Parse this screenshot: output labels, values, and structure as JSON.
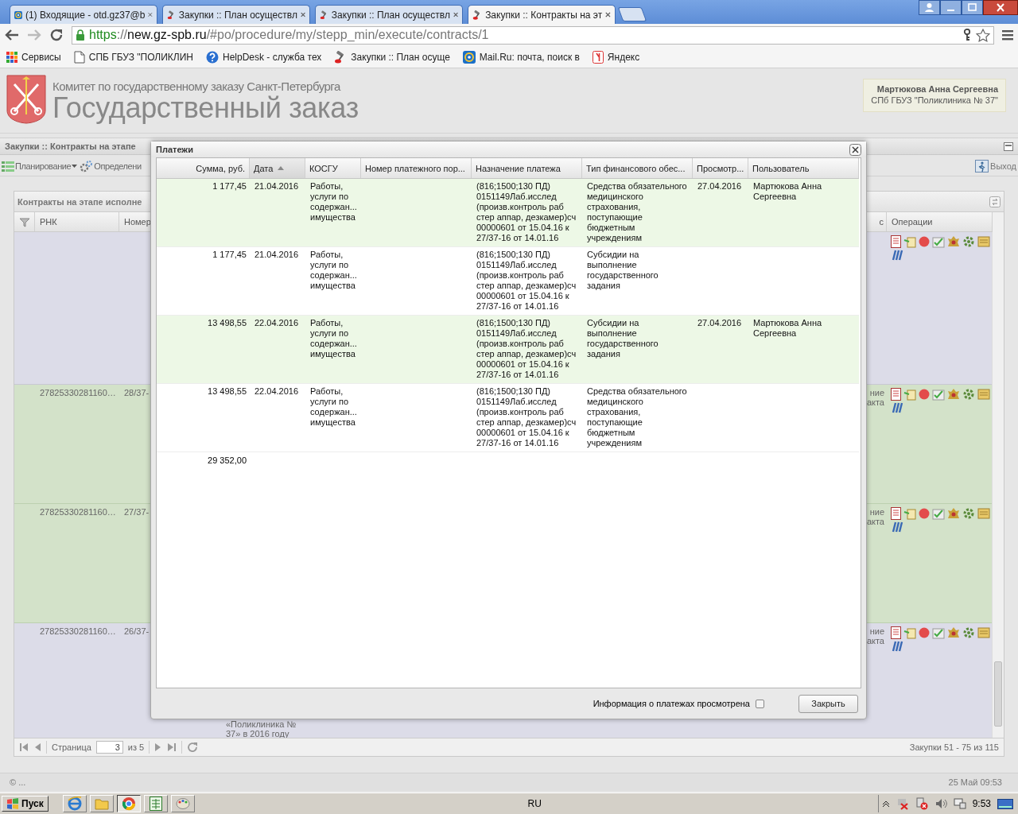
{
  "browser": {
    "tabs": [
      {
        "title": "(1) Входящие - otd.gz37@b",
        "kind": "mail",
        "selected": false
      },
      {
        "title": "Закупки :: План осуществл",
        "kind": "site",
        "selected": false
      },
      {
        "title": "Закупки :: План осуществл",
        "kind": "site",
        "selected": false
      },
      {
        "title": "Закупки :: Контракты на эт",
        "kind": "site",
        "selected": true
      }
    ],
    "address": [
      {
        "text": "https",
        "kind": "scheme"
      },
      {
        "text": "://",
        "kind": "plain"
      },
      {
        "text": "new.gz-spb.ru",
        "kind": "host"
      },
      {
        "text": "/#po/procedure/my/stepp_min/execute/contracts/1",
        "kind": "plain"
      }
    ],
    "bookmarks": [
      {
        "label": "Сервисы",
        "kind": "apps"
      },
      {
        "label": "СПБ ГБУЗ \"ПОЛИКЛИН",
        "kind": "page"
      },
      {
        "label": "HelpDesk - служба тех",
        "kind": "help"
      },
      {
        "label": "Закупки :: План осуще",
        "kind": "site"
      },
      {
        "label": "Mail.Ru: почта, поиск в",
        "kind": "mail"
      },
      {
        "label": "Яндекс",
        "kind": "yandex"
      }
    ]
  },
  "header": {
    "subtitle": "Комитет по государственному заказу Санкт-Петербурга",
    "title": "Государственный заказ",
    "user": {
      "name": "Мартюкова Анна Сергеевна",
      "org": "СПб ГБУЗ \"Поликлиника № 37\""
    }
  },
  "panel": {
    "title": "Закупки :: Контракты на этапе",
    "toolbar": [
      {
        "label": "Планирование",
        "kind": "menu"
      },
      {
        "label": "Определени",
        "kind": "gear"
      }
    ],
    "exit": "Выход",
    "grid": {
      "title": "Контракты на этапе исполне",
      "columns": [
        "РНК",
        "Номер",
        "с",
        "Операции"
      ],
      "rows": [
        {
          "highlighted": false
        },
        {
          "rnk": "27825330281160…",
          "number": "28/37-",
          "status": [
            "ние",
            "акта"
          ],
          "highlighted": true
        },
        {
          "rnk": "27825330281160…",
          "number": "27/37-",
          "status": [
            "ние",
            "акта"
          ],
          "highlighted": true
        },
        {
          "rnk": "27825330281160…",
          "number": "26/37-",
          "status": [
            "ние",
            "акта"
          ],
          "note": "«Поликлиника № 37» в 2016 году",
          "highlighted": false
        }
      ],
      "pager": {
        "page_label": "Страница",
        "page": "3",
        "of": "из 5",
        "summary": "Закупки 51 - 75 из 115"
      }
    }
  },
  "dialog": {
    "title": "Платежи",
    "columns": [
      {
        "label": "Сумма, руб.",
        "sorted": false
      },
      {
        "label": "Дата",
        "sorted": true
      },
      {
        "label": "КОСГУ",
        "sorted": false
      },
      {
        "label": "Номер платежного пор...",
        "sorted": false
      },
      {
        "label": "Назначение платежа",
        "sorted": false
      },
      {
        "label": "Тип финансового обес...",
        "sorted": false
      },
      {
        "label": "Просмотр...",
        "sorted": false
      },
      {
        "label": "Пользователь",
        "sorted": false
      }
    ],
    "rows": [
      {
        "sum": "1 177,45",
        "date": "21.04.2016",
        "kosgu": "Работы, услуги по содержан... имущества",
        "purpose": "(816;1500;130 ПД) 0151149Лаб.исслед (произв.контроль раб стер аппар, дезкамер)сч 00000601 от 15.04.16 к 27/37-16 от 14.01.16",
        "funding": "Средства обязательного медицинского страхования, поступающие бюджетным учреждениям",
        "viewed_on": "27.04.2016",
        "user": "Мартюкова Анна Сергеевна",
        "highlighted": true
      },
      {
        "sum": "1 177,45",
        "date": "21.04.2016",
        "kosgu": "Работы, услуги по содержан... имущества",
        "purpose": "(816;1500;130 ПД) 0151149Лаб.исслед (произв.контроль раб стер аппар, дезкамер)сч 00000601 от 15.04.16 к 27/37-16 от 14.01.16",
        "funding": "Субсидии на выполнение государственного задания",
        "highlighted": false
      },
      {
        "sum": "13 498,55",
        "date": "22.04.2016",
        "kosgu": "Работы, услуги по содержан... имущества",
        "purpose": "(816;1500;130 ПД) 0151149Лаб.исслед (произв.контроль раб стер аппар, дезкамер)сч 00000601 от 15.04.16 к 27/37-16 от 14.01.16",
        "funding": "Субсидии на выполнение государственного задания",
        "viewed_on": "27.04.2016",
        "user": "Мартюкова Анна Сергеевна",
        "highlighted": true
      },
      {
        "sum": "13 498,55",
        "date": "22.04.2016",
        "kosgu": "Работы, услуги по содержан... имущества",
        "purpose": "(816;1500;130 ПД) 0151149Лаб.исслед (произв.контроль раб стер аппар, дезкамер)сч 00000601 от 15.04.16 к 27/37-16 от 14.01.16",
        "funding": "Средства обязательного медицинского страхования, поступающие бюджетным учреждениям",
        "highlighted": false
      }
    ],
    "total": "29 352,00",
    "viewed_label": "Информация о платежах просмотрена",
    "viewed": false,
    "close": "Закрыть"
  },
  "footer": {
    "copyright": "© ...",
    "datetime": "25 Май 09:53"
  },
  "taskbar": {
    "start": "Пуск",
    "apps": [
      {
        "kind": "ie",
        "active": false
      },
      {
        "kind": "folder",
        "active": false
      },
      {
        "kind": "chrome",
        "active": true
      },
      {
        "kind": "sheet",
        "active": false
      },
      {
        "kind": "paint",
        "active": false
      }
    ],
    "lang": "RU",
    "clock": "9:53"
  }
}
